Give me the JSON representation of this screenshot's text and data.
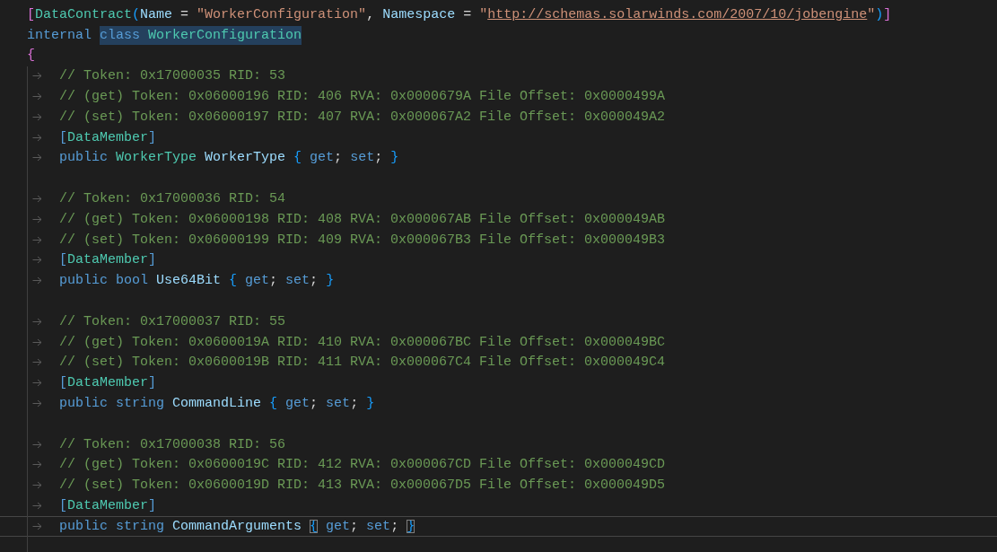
{
  "editor": {
    "lines": [
      {
        "indented": false,
        "current": false,
        "tokens": [
          {
            "kind": "bracket1",
            "text": "[",
            "selected": false
          },
          {
            "kind": "type",
            "text": "DataContract",
            "selected": false
          },
          {
            "kind": "bracket2",
            "text": "(",
            "selected": false
          },
          {
            "kind": "ident",
            "text": "Name",
            "selected": false
          },
          {
            "kind": "punct",
            "text": " = ",
            "selected": false
          },
          {
            "kind": "string",
            "text": "\"WorkerConfiguration\"",
            "selected": false
          },
          {
            "kind": "punct",
            "text": ", ",
            "selected": false
          },
          {
            "kind": "ident",
            "text": "Namespace",
            "selected": false
          },
          {
            "kind": "punct",
            "text": " = ",
            "selected": false
          },
          {
            "kind": "string",
            "text": "\"",
            "selected": false
          },
          {
            "kind": "link",
            "text": "http://schemas.solarwinds.com/2007/10/jobengine",
            "selected": false
          },
          {
            "kind": "string",
            "text": "\"",
            "selected": false
          },
          {
            "kind": "bracket2",
            "text": ")",
            "selected": false
          },
          {
            "kind": "bracket1",
            "text": "]",
            "selected": false
          }
        ]
      },
      {
        "indented": false,
        "current": false,
        "tokens": [
          {
            "kind": "keyword",
            "text": "internal ",
            "selected": false
          },
          {
            "kind": "keyword",
            "text": "class ",
            "selected": true
          },
          {
            "kind": "type",
            "text": "WorkerConfiguration",
            "selected": true
          }
        ]
      },
      {
        "indented": false,
        "current": false,
        "tokens": [
          {
            "kind": "bracket1",
            "text": "{",
            "selected": false
          }
        ]
      },
      {
        "indented": true,
        "current": false,
        "tokens": [
          {
            "kind": "comment",
            "text": "// Token: 0x17000035 RID: 53",
            "selected": false
          }
        ]
      },
      {
        "indented": true,
        "current": false,
        "tokens": [
          {
            "kind": "comment",
            "text": "// (get) Token: 0x06000196 RID: 406 RVA: 0x0000679A File Offset: 0x0000499A",
            "selected": false
          }
        ]
      },
      {
        "indented": true,
        "current": false,
        "tokens": [
          {
            "kind": "comment",
            "text": "// (set) Token: 0x06000197 RID: 407 RVA: 0x000067A2 File Offset: 0x000049A2",
            "selected": false
          }
        ]
      },
      {
        "indented": true,
        "current": false,
        "tokens": [
          {
            "kind": "keyword",
            "text": "[",
            "selected": false
          },
          {
            "kind": "type",
            "text": "DataMember",
            "selected": false
          },
          {
            "kind": "keyword",
            "text": "]",
            "selected": false
          }
        ]
      },
      {
        "indented": true,
        "current": false,
        "tokens": [
          {
            "kind": "keyword",
            "text": "public ",
            "selected": false
          },
          {
            "kind": "type",
            "text": "WorkerType ",
            "selected": false
          },
          {
            "kind": "ident",
            "text": "WorkerType ",
            "selected": false
          },
          {
            "kind": "brace",
            "text": "{",
            "selected": false
          },
          {
            "kind": "keyword",
            "text": " get",
            "selected": false
          },
          {
            "kind": "punct",
            "text": "; ",
            "selected": false
          },
          {
            "kind": "keyword",
            "text": "set",
            "selected": false
          },
          {
            "kind": "punct",
            "text": "; ",
            "selected": false
          },
          {
            "kind": "brace",
            "text": "}",
            "selected": false
          }
        ]
      },
      {
        "indented": false,
        "current": false
      },
      {
        "indented": true,
        "current": false,
        "tokens": [
          {
            "kind": "comment",
            "text": "// Token: 0x17000036 RID: 54",
            "selected": false
          }
        ]
      },
      {
        "indented": true,
        "current": false,
        "tokens": [
          {
            "kind": "comment",
            "text": "// (get) Token: 0x06000198 RID: 408 RVA: 0x000067AB File Offset: 0x000049AB",
            "selected": false
          }
        ]
      },
      {
        "indented": true,
        "current": false,
        "tokens": [
          {
            "kind": "comment",
            "text": "// (set) Token: 0x06000199 RID: 409 RVA: 0x000067B3 File Offset: 0x000049B3",
            "selected": false
          }
        ]
      },
      {
        "indented": true,
        "current": false,
        "tokens": [
          {
            "kind": "keyword",
            "text": "[",
            "selected": false
          },
          {
            "kind": "type",
            "text": "DataMember",
            "selected": false
          },
          {
            "kind": "keyword",
            "text": "]",
            "selected": false
          }
        ]
      },
      {
        "indented": true,
        "current": false,
        "tokens": [
          {
            "kind": "keyword",
            "text": "public ",
            "selected": false
          },
          {
            "kind": "keyword",
            "text": "bool ",
            "selected": false
          },
          {
            "kind": "ident",
            "text": "Use64Bit ",
            "selected": false
          },
          {
            "kind": "brace",
            "text": "{",
            "selected": false
          },
          {
            "kind": "keyword",
            "text": " get",
            "selected": false
          },
          {
            "kind": "punct",
            "text": "; ",
            "selected": false
          },
          {
            "kind": "keyword",
            "text": "set",
            "selected": false
          },
          {
            "kind": "punct",
            "text": "; ",
            "selected": false
          },
          {
            "kind": "brace",
            "text": "}",
            "selected": false
          }
        ]
      },
      {
        "indented": false,
        "current": false
      },
      {
        "indented": true,
        "current": false,
        "tokens": [
          {
            "kind": "comment",
            "text": "// Token: 0x17000037 RID: 55",
            "selected": false
          }
        ]
      },
      {
        "indented": true,
        "current": false,
        "tokens": [
          {
            "kind": "comment",
            "text": "// (get) Token: 0x0600019A RID: 410 RVA: 0x000067BC File Offset: 0x000049BC",
            "selected": false
          }
        ]
      },
      {
        "indented": true,
        "current": false,
        "tokens": [
          {
            "kind": "comment",
            "text": "// (set) Token: 0x0600019B RID: 411 RVA: 0x000067C4 File Offset: 0x000049C4",
            "selected": false
          }
        ]
      },
      {
        "indented": true,
        "current": false,
        "tokens": [
          {
            "kind": "keyword",
            "text": "[",
            "selected": false
          },
          {
            "kind": "type",
            "text": "DataMember",
            "selected": false
          },
          {
            "kind": "keyword",
            "text": "]",
            "selected": false
          }
        ]
      },
      {
        "indented": true,
        "current": false,
        "tokens": [
          {
            "kind": "keyword",
            "text": "public ",
            "selected": false
          },
          {
            "kind": "keyword",
            "text": "string ",
            "selected": false
          },
          {
            "kind": "ident",
            "text": "CommandLine ",
            "selected": false
          },
          {
            "kind": "brace",
            "text": "{",
            "selected": false
          },
          {
            "kind": "keyword",
            "text": " get",
            "selected": false
          },
          {
            "kind": "punct",
            "text": "; ",
            "selected": false
          },
          {
            "kind": "keyword",
            "text": "set",
            "selected": false
          },
          {
            "kind": "punct",
            "text": "; ",
            "selected": false
          },
          {
            "kind": "brace",
            "text": "}",
            "selected": false
          }
        ]
      },
      {
        "indented": false,
        "current": false
      },
      {
        "indented": true,
        "current": false,
        "tokens": [
          {
            "kind": "comment",
            "text": "// Token: 0x17000038 RID: 56",
            "selected": false
          }
        ]
      },
      {
        "indented": true,
        "current": false,
        "tokens": [
          {
            "kind": "comment",
            "text": "// (get) Token: 0x0600019C RID: 412 RVA: 0x000067CD File Offset: 0x000049CD",
            "selected": false
          }
        ]
      },
      {
        "indented": true,
        "current": false,
        "tokens": [
          {
            "kind": "comment",
            "text": "// (set) Token: 0x0600019D RID: 413 RVA: 0x000067D5 File Offset: 0x000049D5",
            "selected": false
          }
        ]
      },
      {
        "indented": true,
        "current": false,
        "tokens": [
          {
            "kind": "keyword",
            "text": "[",
            "selected": false
          },
          {
            "kind": "type",
            "text": "DataMember",
            "selected": false
          },
          {
            "kind": "keyword",
            "text": "]",
            "selected": false
          }
        ]
      },
      {
        "indented": true,
        "current": true,
        "tokens": [
          {
            "kind": "keyword",
            "text": "public ",
            "selected": false
          },
          {
            "kind": "keyword",
            "text": "string ",
            "selected": false
          },
          {
            "kind": "ident",
            "text": "CommandArguments ",
            "selected": false
          },
          {
            "kind": "matched-brace",
            "text": "{",
            "selected": false
          },
          {
            "kind": "keyword",
            "text": " get",
            "selected": false
          },
          {
            "kind": "punct",
            "text": "; ",
            "selected": false
          },
          {
            "kind": "keyword",
            "text": "set",
            "selected": false
          },
          {
            "kind": "punct",
            "text": "; ",
            "selected": false
          },
          {
            "kind": "matched-brace",
            "text": "}",
            "selected": false
          }
        ]
      },
      {
        "indented": false,
        "current": false
      }
    ]
  }
}
